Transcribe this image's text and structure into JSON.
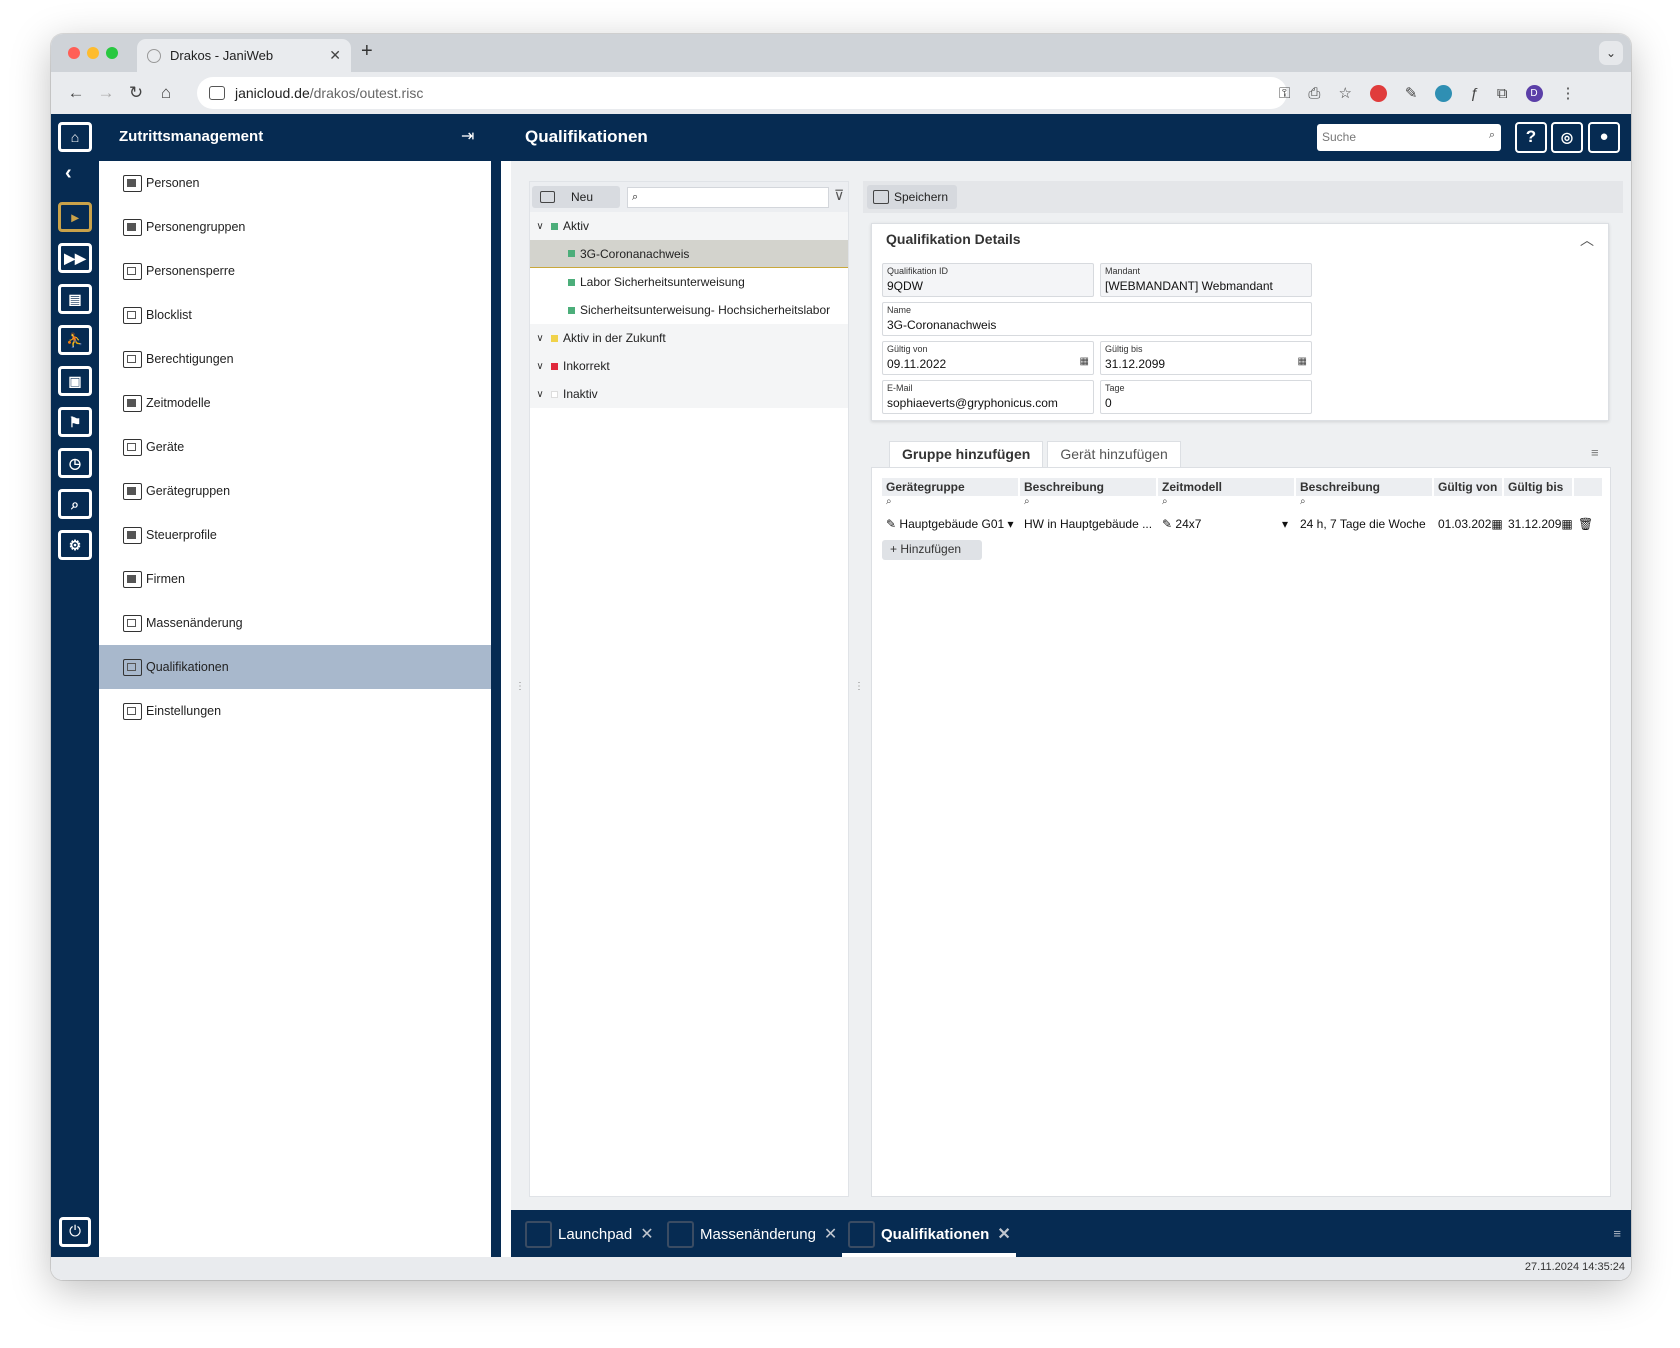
{
  "browser": {
    "tab_title": "Drakos - JaniWeb",
    "tab_close": "✕",
    "new_tab": "+",
    "url_host": "janicloud.de",
    "url_path": "/drakos/outest.risc",
    "profile_letter": "D"
  },
  "app": {
    "name": "Zutrittsmanagement",
    "page_title": "Qualifikationen",
    "search_placeholder": "Suche",
    "help_label": "?"
  },
  "sidebar": {
    "items": [
      {
        "label": "Personen"
      },
      {
        "label": "Personengruppen"
      },
      {
        "label": "Personensperre"
      },
      {
        "label": "Blocklist"
      },
      {
        "label": "Berechtigungen"
      },
      {
        "label": "Zeitmodelle"
      },
      {
        "label": "Geräte"
      },
      {
        "label": "Gerätegruppen"
      },
      {
        "label": "Steuerprofile"
      },
      {
        "label": "Firmen"
      },
      {
        "label": "Massenänderung"
      },
      {
        "label": "Qualifikationen"
      },
      {
        "label": "Einstellungen"
      }
    ],
    "active_index": 11
  },
  "list_panel": {
    "new_label": "Neu",
    "tree": [
      {
        "label": "Aktiv",
        "type": "group",
        "color": "#4cae7a"
      },
      {
        "label": "3G-Coronanachweis",
        "type": "item",
        "color": "#4cae7a",
        "selected": true
      },
      {
        "label": "Labor Sicherheitsunterweisung",
        "type": "item",
        "color": "#4cae7a"
      },
      {
        "label": "Sicherheitsunterweisung- Hochsicherheitslabor",
        "type": "item",
        "color": "#4cae7a"
      },
      {
        "label": "Aktiv in der Zukunft",
        "type": "group",
        "color": "#f0d24a"
      },
      {
        "label": "Inkorrekt",
        "type": "group",
        "color": "#e0283c"
      },
      {
        "label": "Inaktiv",
        "type": "group",
        "color": "#ffffff"
      }
    ]
  },
  "details": {
    "save_label": "Speichern",
    "title": "Qualifikation Details",
    "fields": {
      "id_label": "Qualifikation ID",
      "id_value": "9QDW",
      "mandant_label": "Mandant",
      "mandant_value": "[WEBMANDANT] Webmandant",
      "name_label": "Name",
      "name_value": "3G-Coronanachweis",
      "from_label": "Gültig von",
      "from_value": "09.11.2022",
      "to_label": "Gültig bis",
      "to_value": "31.12.2099",
      "email_label": "E-Mail",
      "email_value": "sophiaeverts@gryphonicus.com",
      "days_label": "Tage",
      "days_value": "0"
    }
  },
  "assign": {
    "tabs": [
      "Gruppe hinzufügen",
      "Gerät hinzufügen"
    ],
    "columns": [
      "Gerätegruppe",
      "Beschreibung",
      "Zeitmodell",
      "Beschreibung",
      "Gültig von",
      "Gültig bis"
    ],
    "rows": [
      {
        "group": "Hauptgebäude G01",
        "group_desc": "HW in Hauptgebäude ...",
        "timemodel": "24x7",
        "timemodel_desc": "24 h, 7 Tage die Woche",
        "from": "01.03.202",
        "to": "31.12.209"
      }
    ],
    "add_label": "Hinzufügen"
  },
  "bottom_tabs": [
    {
      "label": "Launchpad"
    },
    {
      "label": "Massenänderung"
    },
    {
      "label": "Qualifikationen",
      "active": true
    }
  ],
  "status": {
    "timestamp": "27.11.2024 14:35:24"
  },
  "colors": {
    "primary": "#062b52",
    "active_item": "#a8b8cc",
    "selected_row": "#d3d3cd",
    "accent_gold": "#c9a24a"
  }
}
